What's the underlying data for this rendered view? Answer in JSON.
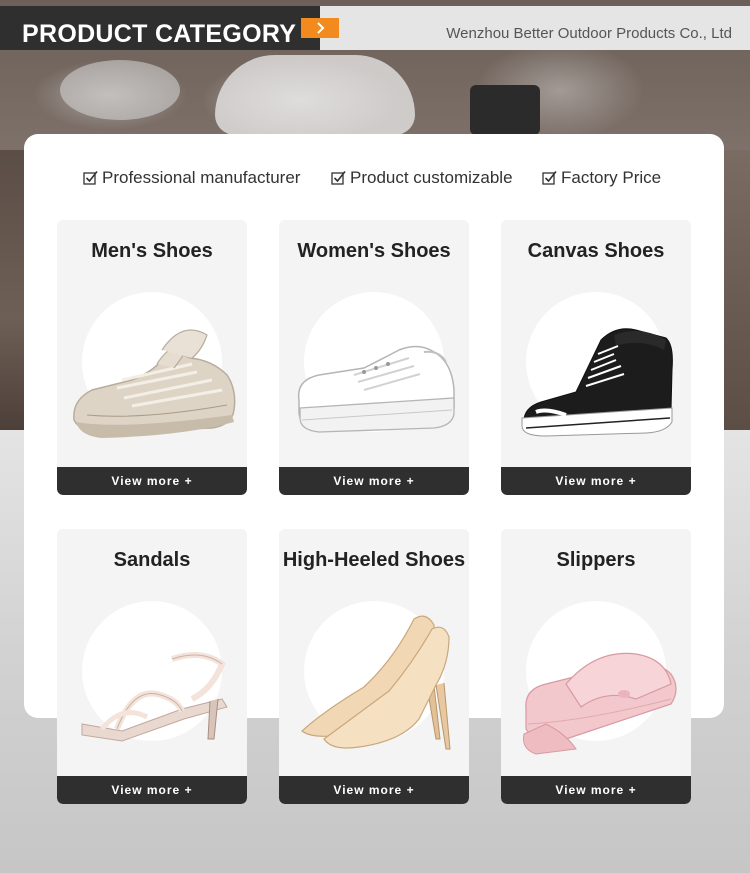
{
  "header": {
    "title": "PRODUCT CATEGORY",
    "company": "Wenzhou Better Outdoor Products Co., Ltd",
    "arrow_icon": "chevron-right-icon",
    "accent_color": "#f28a1e",
    "dark_color": "#2f2f2f"
  },
  "features": [
    {
      "label": "Professional manufacturer",
      "icon": "checkbox-checked-icon"
    },
    {
      "label": "Product customizable",
      "icon": "checkbox-checked-icon"
    },
    {
      "label": "Factory Price",
      "icon": "checkbox-checked-icon"
    }
  ],
  "categories": [
    {
      "title": "Men's Shoes",
      "button": "View more +",
      "icon": "sneaker-image"
    },
    {
      "title": "Women's Shoes",
      "button": "View more +",
      "icon": "white-platform-sneaker-image"
    },
    {
      "title": "Canvas Shoes",
      "button": "View more +",
      "icon": "canvas-high-top-image"
    },
    {
      "title": "Sandals",
      "button": "View more +",
      "icon": "strappy-sandal-image"
    },
    {
      "title": "High-Heeled Shoes",
      "button": "View more +",
      "icon": "pump-heel-image"
    },
    {
      "title": "Slippers",
      "button": "View more +",
      "icon": "pink-slide-slipper-image"
    }
  ]
}
